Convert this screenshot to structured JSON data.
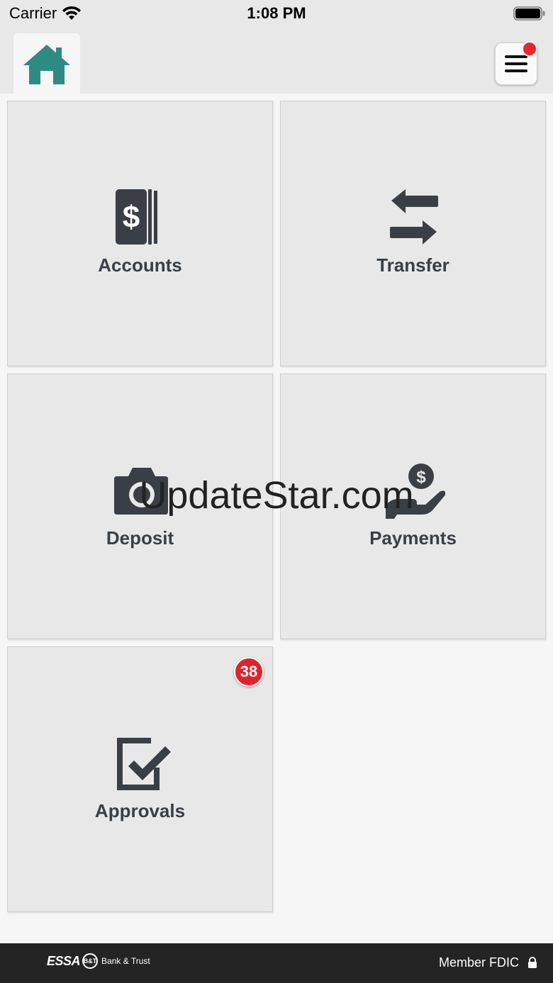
{
  "status_bar": {
    "carrier": "Carrier",
    "time": "1:08 PM",
    "icons": [
      "wifi-icon",
      "battery-icon"
    ]
  },
  "header": {
    "home_icon": "home-icon",
    "home_color": "#2e8b84",
    "menu_icon": "hamburger-menu-icon",
    "menu_has_notification": true,
    "notification_color": "#e8262d"
  },
  "tiles": [
    {
      "label": "Accounts",
      "icon": "dollar-bills-icon"
    },
    {
      "label": "Transfer",
      "icon": "transfer-arrows-icon"
    },
    {
      "label": "Deposit",
      "icon": "camera-icon"
    },
    {
      "label": "Payments",
      "icon": "hand-coin-icon"
    },
    {
      "label": "Approvals",
      "icon": "checkbox-icon",
      "badge": "38"
    }
  ],
  "watermark": "UpdateStar.com",
  "footer": {
    "brand_name": "ESSA",
    "brand_mark": "B&T",
    "brand_sub": "Bank & Trust",
    "fdic_label": "Member FDIC",
    "fdic_icon": "lock-icon"
  },
  "colors": {
    "icon_dark": "#3a3f45",
    "badge_red": "#e2222b",
    "footer_bg": "#242424"
  }
}
